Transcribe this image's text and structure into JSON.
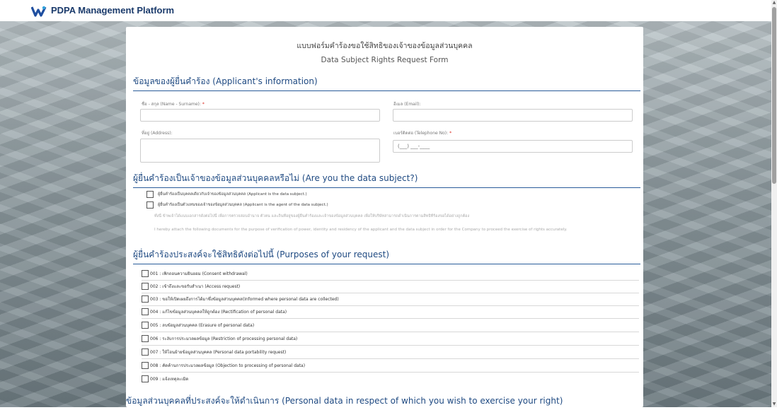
{
  "app": {
    "title": "PDPA Management Platform"
  },
  "form": {
    "title_th": "แบบฟอร์มคำร้องขอใช้สิทธิของเจ้าของข้อมูลส่วนบุคคล",
    "title_en": "Data Subject Rights Request Form"
  },
  "applicant": {
    "heading": "ข้อมูลของผู้ยื่นคำร้อง (Applicant's information)",
    "name_label": "ชื่อ - สกุล (Name - Surname):",
    "email_label": "อีเมล (Email):",
    "address_label": "ที่อยู่ (Address):",
    "phone_label": "เบอร์ติดต่อ (Telephone No):",
    "phone_placeholder": "(___) ___-____",
    "required_mark": "*"
  },
  "subject": {
    "heading": "ผู้ยื่นคำร้องเป็นเจ้าของข้อมูลส่วนบุคคลหรือไม่ (Are you the data subject?)",
    "option1": "ผู้ยื่นคำร้องเป็นบุคคลเดียวกับเจ้าของข้อมูลส่วนบุคคล (Applicant is the data subject.)",
    "option2": "ผู้ยื่นคำร้องเป็นตัวแทนของเจ้าของข้อมูลส่วนบุคคล (Applicant is the agent of the data subject.)",
    "note_th": "ทั้งนี้ ข้าพเจ้าได้แนบเอกสารดังต่อไปนี้ เพื่อการตรวจสอบอำนาจ ตัวตน และถิ่นที่อยู่ของผู้ยื่นคำร้องและเจ้าของข้อมูลส่วนบุคคล เพื่อให้บริษัทสามารถดำเนินการตามสิทธิที่ร้องขอได้อย่างถูกต้อง",
    "note_en": "I hereby attach the following documents for the purpose of verification of power, identity and residency of the applicant and the data subject in order for the Company to proceed the exercise of rights accurately."
  },
  "purposes": {
    "heading": "ผู้ยื่นคำร้องประสงค์จะใช้สิทธิดังต่อไปนี้ (Purposes of your request)",
    "items": [
      "001 : เพิกถอนความยินยอม (Consent withdrawal)",
      "002 : เข้าถึงและขอรับสำเนา (Access request)",
      "003 : ขอให้เปิดเผยถึงการได้มาซึ่งข้อมูลส่วนบุคคล(Informed where personal data are collected)",
      "004 : แก้ไขข้อมูลส่วนบุคคลให้ถูกต้อง (Rectification of personal data)",
      "005 : ลบข้อมูลส่วนบุคคล (Erasure of personal data)",
      "006 : ระงับการประมวลผลข้อมูล (Restriction of processing personal data)",
      "007 : ให้โอนย้ายข้อมูลส่วนบุคคล (Personal data portability request)",
      "008 : คัดค้านการประมวลผลข้อมูล (Objection to processing of personal data)",
      "009 : แจ้งเหตุละเมิด"
    ]
  },
  "personal_data": {
    "heading": "ข้อมูลส่วนบุคคลที่ประสงค์จะให้ดำเนินการ (Personal data in respect of which you wish to exercise your right)"
  }
}
